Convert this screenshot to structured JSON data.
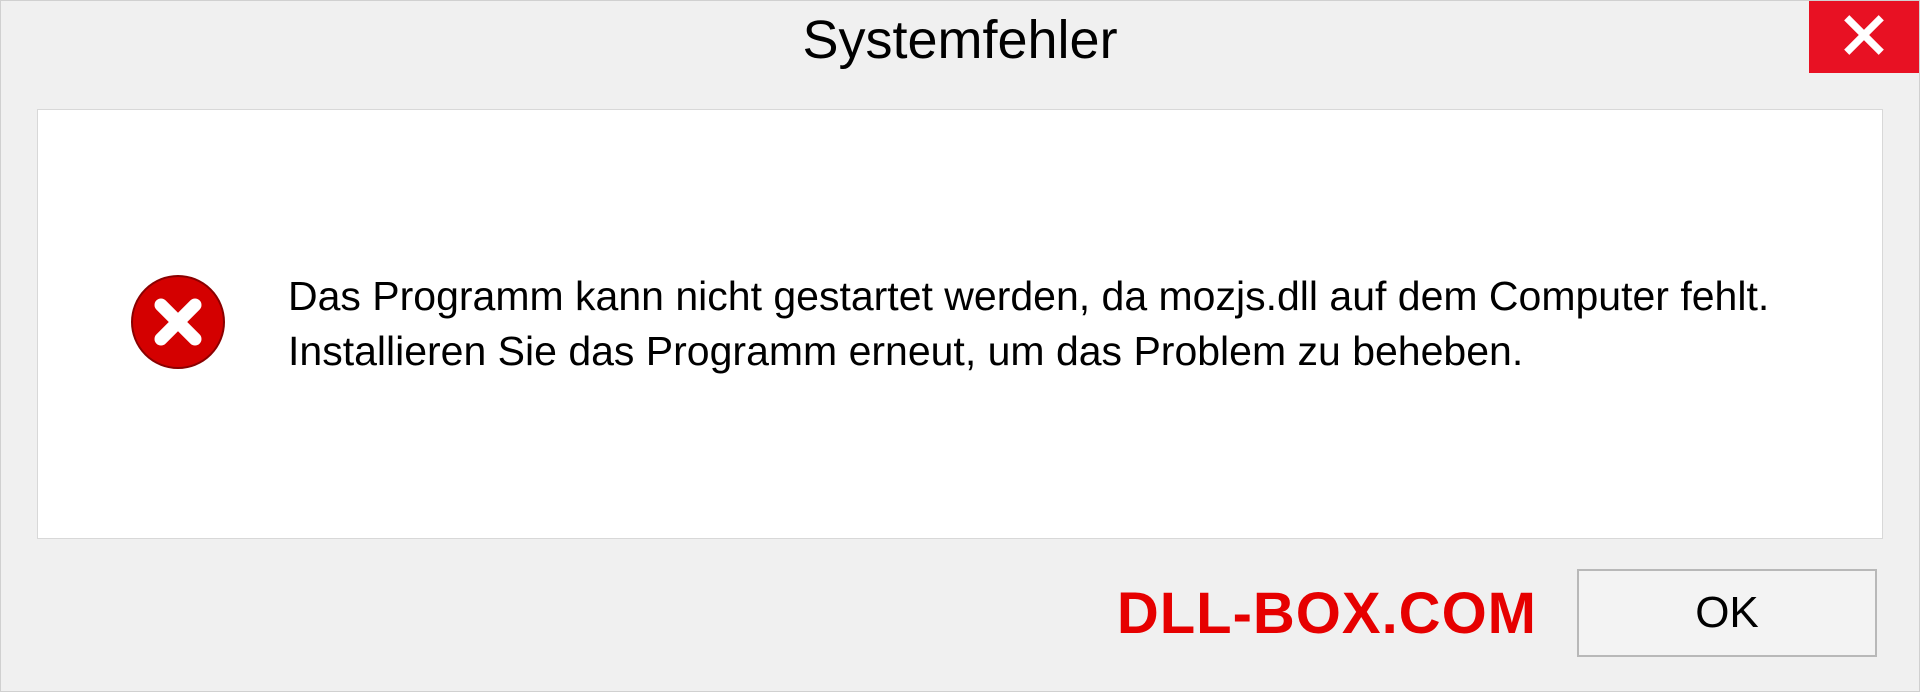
{
  "dialog": {
    "title": "Systemfehler",
    "message": "Das Programm kann nicht gestartet werden, da mozjs.dll auf dem Computer fehlt. Installieren Sie das Programm erneut, um das Problem zu beheben.",
    "ok_label": "OK"
  },
  "watermark": "DLL-BOX.COM",
  "colors": {
    "close_bg": "#e81123",
    "error_red": "#d40000",
    "watermark": "#e60000"
  }
}
